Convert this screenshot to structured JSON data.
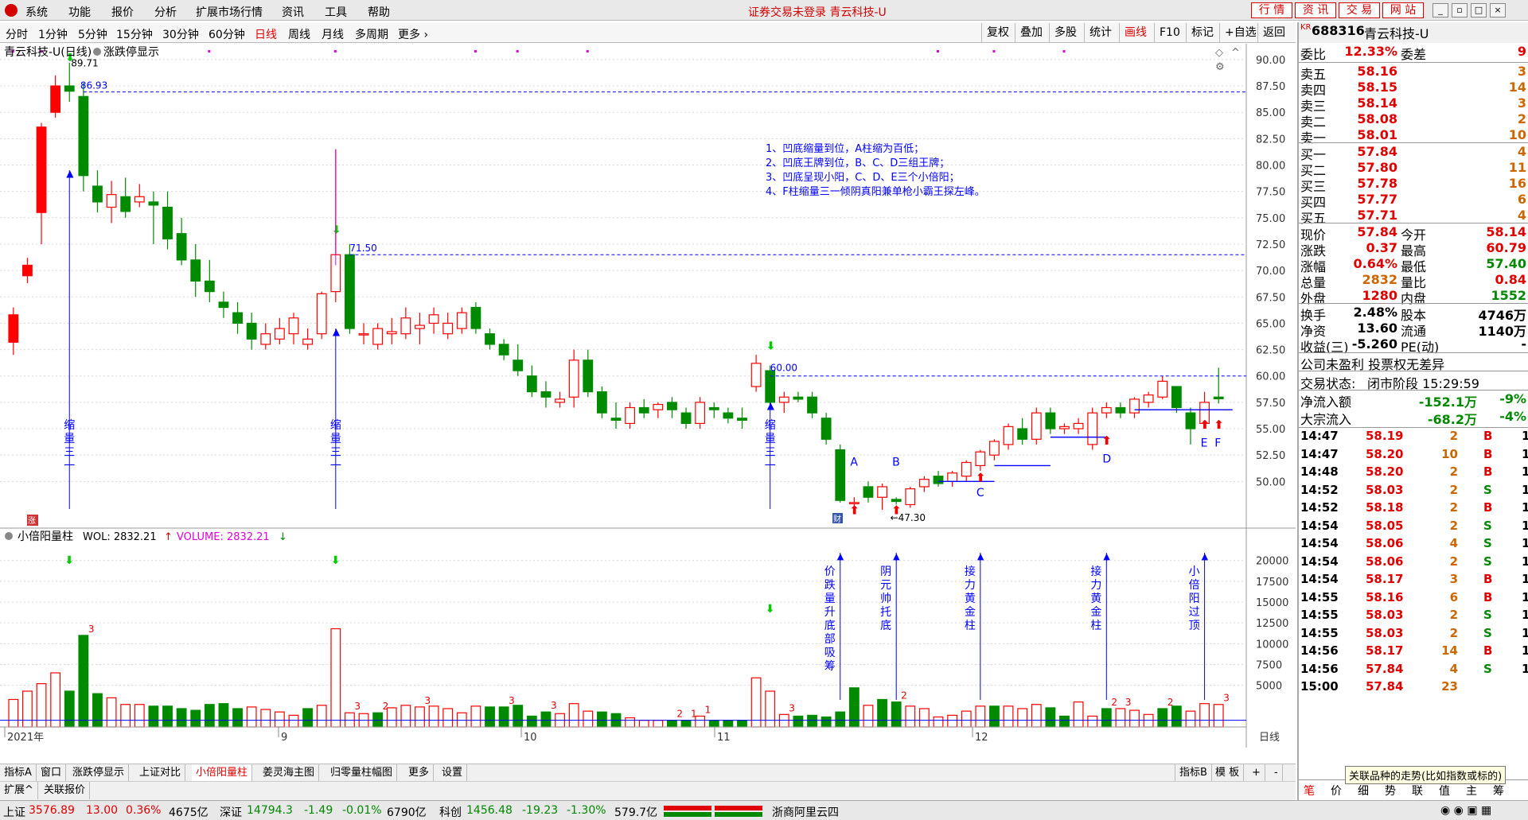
{
  "menu": {
    "items": [
      "系统",
      "功能",
      "报价",
      "分析",
      "扩展市场行情",
      "资讯",
      "工具",
      "帮助"
    ],
    "status_title": "证券交易未登录  青云科技-U",
    "right_buttons": [
      "行 情",
      "资 讯",
      "交 易",
      "网 站"
    ]
  },
  "periods": {
    "items": [
      "分时",
      "1分钟",
      "5分钟",
      "15分钟",
      "30分钟",
      "60分钟",
      "日线",
      "周线",
      "月线",
      "多周期",
      "更多"
    ],
    "active": "日线",
    "right_tools": [
      "复权",
      "叠加",
      "多股",
      "统计",
      "画线",
      "F10",
      "标记",
      "+自选",
      "返回"
    ],
    "active_tool": "画线"
  },
  "main_chart": {
    "title": "青云科技-U(日线)",
    "indicator": "涨跌停显示",
    "high_label": "89.71",
    "high_line_label": "86.93",
    "label_7150": "71.50",
    "label_6000": "60.00",
    "low_label": "47.30",
    "notes": [
      "1、凹底缩量到位，A柱缩为百低；",
      "2、凹底王牌到位，B、C、D三组王牌；",
      "3、凹底呈现小阳，C、D、E三个小倍阳；",
      "4、F柱缩量三一倾阴真阳兼单枪小霸王探左峰。"
    ],
    "shrink_label": "缩量三一",
    "letters": [
      "A",
      "B",
      "C",
      "D",
      "E",
      "F"
    ],
    "cai_badge": "财",
    "zhang_badge": "涨"
  },
  "vol_chart": {
    "title": "小倍阳量柱",
    "wol_label": "WOL: 2832.21",
    "volume_label": "VOLUME: 2832.21",
    "annotations": [
      "价跌量升底部吸筹",
      "阴元帅托底",
      "接力黄金柱",
      "接力黄金柱",
      "小倍阳过顶"
    ],
    "counts": [
      "3",
      "3",
      "2",
      "3",
      "3",
      "3",
      "2",
      "1",
      "1",
      "3",
      "2",
      "2",
      "3",
      "2",
      "3"
    ]
  },
  "chart_data": [
    {
      "type": "candlestick",
      "name": "price",
      "ylim": [
        45.5,
        91.5
      ],
      "yticks": [
        "90.00",
        "87.50",
        "85.00",
        "82.50",
        "80.00",
        "77.50",
        "75.00",
        "72.50",
        "70.00",
        "67.50",
        "65.00",
        "62.50",
        "60.00",
        "57.50",
        "55.00",
        "52.50",
        "50.00"
      ],
      "xticks": [
        "2021年",
        "9",
        "10",
        "11",
        "12"
      ],
      "period_label": "日线",
      "candles": [
        [
          63.2,
          66.5,
          62.0,
          65.8
        ],
        [
          69.5,
          71.2,
          68.8,
          70.5
        ],
        [
          75.5,
          84.0,
          72.5,
          83.6
        ],
        [
          85.0,
          88.5,
          84.5,
          87.5
        ],
        [
          87.5,
          89.71,
          86.0,
          87.0
        ],
        [
          86.5,
          87.8,
          77.5,
          79.0
        ],
        [
          78.0,
          79.5,
          75.5,
          76.5
        ],
        [
          76.0,
          78.5,
          74.5,
          77.2
        ],
        [
          77.0,
          78.8,
          75.0,
          75.6
        ],
        [
          76.5,
          78.2,
          76.0,
          77.0
        ],
        [
          76.5,
          77.5,
          72.5,
          76.2
        ],
        [
          76.0,
          77.5,
          72.0,
          73.0
        ],
        [
          73.5,
          75.0,
          70.5,
          71.0
        ],
        [
          71.0,
          72.5,
          67.5,
          69.0
        ],
        [
          69.0,
          71.0,
          67.0,
          68.0
        ],
        [
          67.0,
          68.0,
          65.5,
          66.5
        ],
        [
          66.0,
          67.0,
          64.0,
          65.0
        ],
        [
          65.0,
          66.0,
          62.5,
          63.5
        ],
        [
          63.0,
          65.0,
          62.5,
          64.0
        ],
        [
          63.5,
          65.5,
          63.0,
          64.5
        ],
        [
          64.0,
          66.0,
          63.0,
          65.5
        ],
        [
          63.0,
          64.5,
          62.5,
          63.5
        ],
        [
          64.0,
          68.0,
          63.5,
          67.8
        ],
        [
          68.0,
          81.5,
          67.0,
          71.5
        ],
        [
          71.5,
          72.5,
          64.0,
          64.5
        ],
        [
          64.0,
          65.0,
          63.0,
          64.0
        ],
        [
          63.0,
          65.0,
          62.5,
          64.5
        ],
        [
          64.0,
          65.5,
          63.0,
          64.2
        ],
        [
          64.0,
          66.5,
          63.5,
          65.5
        ],
        [
          64.5,
          66.0,
          63.0,
          64.8
        ],
        [
          65.0,
          66.5,
          64.0,
          65.8
        ],
        [
          64.0,
          66.0,
          63.5,
          65.0
        ],
        [
          64.5,
          66.5,
          64.0,
          66.0
        ],
        [
          66.5,
          67.0,
          64.0,
          64.5
        ],
        [
          64.0,
          64.5,
          62.5,
          63.0
        ],
        [
          63.0,
          63.5,
          61.5,
          62.0
        ],
        [
          61.5,
          63.0,
          60.0,
          60.5
        ],
        [
          60.0,
          61.0,
          58.0,
          58.5
        ],
        [
          58.5,
          59.5,
          57.0,
          58.0
        ],
        [
          57.5,
          58.5,
          57.0,
          57.8
        ],
        [
          58.0,
          62.5,
          57.0,
          61.5
        ],
        [
          61.5,
          62.5,
          58.0,
          58.5
        ],
        [
          58.5,
          59.0,
          56.0,
          56.5
        ],
        [
          56.0,
          57.5,
          55.0,
          55.8
        ],
        [
          55.5,
          57.5,
          55.0,
          57.0
        ],
        [
          57.0,
          57.8,
          56.0,
          56.5
        ],
        [
          56.8,
          57.5,
          56.0,
          57.3
        ],
        [
          57.5,
          58.0,
          56.0,
          56.8
        ],
        [
          56.5,
          57.0,
          55.0,
          55.5
        ],
        [
          55.5,
          58.0,
          55.0,
          57.5
        ],
        [
          57.0,
          57.5,
          56.0,
          56.8
        ],
        [
          56.5,
          57.0,
          55.5,
          56.0
        ],
        [
          56.0,
          57.0,
          55.0,
          55.8
        ],
        [
          59.0,
          62.0,
          58.5,
          61.2
        ],
        [
          60.5,
          61.0,
          57.0,
          57.5
        ],
        [
          57.5,
          58.5,
          56.5,
          58.0
        ],
        [
          58.0,
          58.5,
          57.5,
          57.8
        ],
        [
          58.0,
          58.5,
          56.0,
          56.5
        ],
        [
          56.0,
          56.5,
          53.5,
          54.0
        ],
        [
          53.0,
          53.5,
          48.0,
          48.2
        ],
        [
          48.0,
          48.5,
          47.5,
          48.0
        ],
        [
          49.5,
          50.0,
          48.0,
          48.5
        ],
        [
          48.5,
          49.8,
          47.3,
          49.5
        ],
        [
          48.3,
          48.5,
          47.8,
          48.1
        ],
        [
          47.8,
          49.5,
          47.5,
          49.3
        ],
        [
          49.5,
          50.5,
          49.0,
          50.2
        ],
        [
          50.5,
          51.0,
          49.5,
          49.8
        ],
        [
          50.0,
          51.0,
          49.5,
          50.8
        ],
        [
          50.5,
          52.0,
          50.0,
          51.8
        ],
        [
          51.5,
          53.0,
          51.0,
          52.8
        ],
        [
          52.5,
          54.0,
          52.0,
          53.8
        ],
        [
          53.5,
          55.5,
          53.0,
          55.2
        ],
        [
          55.0,
          56.0,
          53.5,
          54.0
        ],
        [
          54.0,
          57.0,
          53.5,
          56.5
        ],
        [
          56.5,
          57.0,
          54.5,
          55.0
        ],
        [
          55.0,
          55.5,
          54.5,
          55.2
        ],
        [
          55.0,
          56.0,
          54.5,
          55.5
        ],
        [
          53.5,
          57.0,
          53.0,
          56.5
        ],
        [
          56.5,
          57.5,
          56.0,
          57.0
        ],
        [
          57.0,
          57.5,
          56.0,
          56.5
        ],
        [
          56.5,
          58.0,
          56.0,
          57.8
        ],
        [
          57.5,
          58.5,
          57.0,
          58.2
        ],
        [
          58.0,
          60.0,
          57.8,
          59.5
        ],
        [
          59.0,
          59.0,
          56.5,
          57.0
        ],
        [
          56.5,
          57.0,
          53.5,
          55.0
        ],
        [
          55.5,
          58.5,
          55.0,
          57.5
        ],
        [
          58.0,
          60.79,
          57.4,
          57.84
        ]
      ]
    },
    {
      "type": "bar",
      "name": "volume",
      "ylim": [
        0,
        21500
      ],
      "yticks": [
        "20000",
        "17500",
        "15000",
        "12500",
        "10000",
        "7500",
        "5000"
      ],
      "up": [
        1,
        1,
        1,
        1,
        0,
        0,
        0,
        1,
        1,
        1,
        0,
        0,
        0,
        0,
        0,
        0,
        0,
        1,
        1,
        1,
        1,
        0,
        1,
        1,
        1,
        1,
        0,
        1,
        1,
        1,
        1,
        1,
        1,
        1,
        0,
        0,
        0,
        0,
        0,
        1,
        1,
        1,
        0,
        0,
        1,
        1,
        1,
        0,
        0,
        1,
        0,
        0,
        0,
        1,
        1,
        1,
        0,
        0,
        0,
        0,
        0,
        1,
        0,
        0,
        1,
        1,
        1,
        1,
        1,
        1,
        0,
        1,
        1,
        1,
        0,
        0,
        1,
        1,
        0,
        1,
        1,
        1,
        0,
        0,
        1,
        1,
        1
      ],
      "values": [
        3300,
        4300,
        5200,
        6500,
        4300,
        11000,
        4000,
        3500,
        2700,
        2700,
        2500,
        2500,
        2200,
        2000,
        2700,
        2800,
        2200,
        2400,
        2100,
        1800,
        1400,
        2200,
        2600,
        11800,
        1700,
        1600,
        1700,
        2300,
        2600,
        2400,
        2500,
        2200,
        1700,
        2500,
        2400,
        2400,
        2600,
        1300,
        1800,
        1600,
        2800,
        1900,
        1800,
        1600,
        1100,
        800,
        800,
        800,
        800,
        1300,
        800,
        800,
        800,
        5900,
        4300,
        1500,
        1300,
        1400,
        1200,
        1800,
        4700,
        2600,
        3300,
        3000,
        2500,
        2200,
        1200,
        1400,
        1900,
        2500,
        2500,
        2500,
        2200,
        2700,
        2300,
        1300,
        3000,
        1300,
        2200,
        2200,
        2000,
        1500,
        2200,
        2500,
        1900,
        2800,
        2700
      ]
    }
  ],
  "quote": {
    "code": "688316",
    "name": "青云科技-U",
    "kr": "KR",
    "weibi_label": "委比",
    "weibi": "12.33%",
    "weicha_label": "委差",
    "weicha": "9",
    "asks": [
      {
        "label": "卖五",
        "price": "58.16",
        "vol": "3"
      },
      {
        "label": "卖四",
        "price": "58.15",
        "vol": "14"
      },
      {
        "label": "卖三",
        "price": "58.14",
        "vol": "3"
      },
      {
        "label": "卖二",
        "price": "58.08",
        "vol": "2"
      },
      {
        "label": "卖一",
        "price": "58.01",
        "vol": "10"
      }
    ],
    "bids": [
      {
        "label": "买一",
        "price": "57.84",
        "vol": "4"
      },
      {
        "label": "买二",
        "price": "57.80",
        "vol": "11"
      },
      {
        "label": "买三",
        "price": "57.78",
        "vol": "16"
      },
      {
        "label": "买四",
        "price": "57.77",
        "vol": "6"
      },
      {
        "label": "买五",
        "price": "57.71",
        "vol": "4"
      }
    ],
    "stats": [
      {
        "l1": "现价",
        "v1": "57.84",
        "l2": "今开",
        "v2": "58.14",
        "c1": "red",
        "c2": "red"
      },
      {
        "l1": "涨跌",
        "v1": "0.37",
        "l2": "最高",
        "v2": "60.79",
        "c1": "red",
        "c2": "red"
      },
      {
        "l1": "涨幅",
        "v1": "0.64%",
        "l2": "最低",
        "v2": "57.40",
        "c1": "red",
        "c2": "green"
      },
      {
        "l1": "总量",
        "v1": "2832",
        "l2": "量比",
        "v2": "0.84",
        "c1": "orange",
        "c2": "red"
      },
      {
        "l1": "外盘",
        "v1": "1280",
        "l2": "内盘",
        "v2": "1552",
        "c1": "red",
        "c2": "green"
      }
    ],
    "stats2": [
      {
        "l1": "换手",
        "v1": "2.48%",
        "l2": "股本",
        "v2": "4746万"
      },
      {
        "l1": "净资",
        "v1": "13.60",
        "l2": "流通",
        "v2": "1140万"
      },
      {
        "l1": "收益(三)",
        "v1": "-5.260",
        "l2": "PE(动)",
        "v2": "-"
      }
    ],
    "profit_note": "公司未盈利  投票权无差异",
    "trade_state_label": "交易状态:",
    "trade_state": "闭市阶段  15:29:59",
    "flows": [
      {
        "label": "净流入额",
        "value": "-152.1万",
        "pct": "-9%"
      },
      {
        "label": "大宗流入",
        "value": "-68.2万",
        "pct": "-4%"
      }
    ],
    "ticks": [
      {
        "t": "14:47",
        "p": "58.19",
        "v": "2",
        "d": "B",
        "n": "1"
      },
      {
        "t": "14:47",
        "p": "58.20",
        "v": "10",
        "d": "B",
        "n": "1"
      },
      {
        "t": "14:48",
        "p": "58.20",
        "v": "2",
        "d": "B",
        "n": "1"
      },
      {
        "t": "14:52",
        "p": "58.03",
        "v": "2",
        "d": "S",
        "n": "1"
      },
      {
        "t": "14:52",
        "p": "58.18",
        "v": "2",
        "d": "B",
        "n": "1"
      },
      {
        "t": "14:54",
        "p": "58.05",
        "v": "2",
        "d": "S",
        "n": "1"
      },
      {
        "t": "14:54",
        "p": "58.06",
        "v": "4",
        "d": "S",
        "n": "1"
      },
      {
        "t": "14:54",
        "p": "58.06",
        "v": "2",
        "d": "S",
        "n": "1"
      },
      {
        "t": "14:54",
        "p": "58.17",
        "v": "3",
        "d": "B",
        "n": "1"
      },
      {
        "t": "14:55",
        "p": "58.16",
        "v": "6",
        "d": "B",
        "n": "1"
      },
      {
        "t": "14:55",
        "p": "58.03",
        "v": "2",
        "d": "S",
        "n": "1"
      },
      {
        "t": "14:55",
        "p": "58.03",
        "v": "2",
        "d": "S",
        "n": "1"
      },
      {
        "t": "14:56",
        "p": "58.17",
        "v": "14",
        "d": "B",
        "n": "1"
      },
      {
        "t": "14:56",
        "p": "57.84",
        "v": "4",
        "d": "S",
        "n": "1"
      },
      {
        "t": "15:00",
        "p": "57.84",
        "v": "23",
        "d": "",
        "n": ""
      }
    ],
    "bottom_tabs": [
      "笔",
      "价",
      "细",
      "势",
      "联",
      "值",
      "主",
      "筹"
    ],
    "tooltip": "关联品种的走势(比如指数或标的)"
  },
  "bottom_tabs": [
    "指标A",
    "窗口",
    "涨跌停显示",
    "上证对比",
    "小倍阳量柱",
    "姜灵海主图",
    "归零量柱幅图",
    "更多",
    "设置"
  ],
  "active_bottom_tab": "小倍阳量柱",
  "bottom_tabs_right": [
    "指标B",
    "模 板",
    "+",
    "-"
  ],
  "bottom_tabs2": [
    "扩展",
    "关联报价"
  ],
  "index_bar": {
    "sh_label": "上证",
    "sh_val": "3576.89",
    "sh_chg": "13.00",
    "sh_pct": "0.36%",
    "sh_amt": "4675亿",
    "sz_label": "深证",
    "sz_val": "14794.3",
    "sz_chg": "-1.49",
    "sz_pct": "-0.01%",
    "sz_amt": "6790亿",
    "kc_label": "科创",
    "kc_val": "1456.48",
    "kc_chg": "-19.23",
    "kc_pct": "-1.30%",
    "kc_amt": "579.7亿",
    "server": "浙商阿里云四"
  },
  "colors": {
    "up": "#ff0000",
    "down": "#008a00",
    "blue": "#0000ff",
    "accent": "#e00000"
  }
}
